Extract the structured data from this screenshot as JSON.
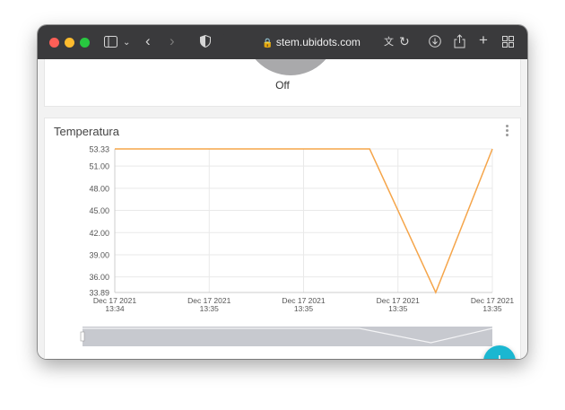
{
  "browser": {
    "url": "stem.ubidots.com",
    "colors": {
      "close": "#fe5f57",
      "minimize": "#febc2e",
      "zoom": "#28c840"
    }
  },
  "switch_widget": {
    "status": "Off"
  },
  "chart_widget": {
    "title": "Temperatura",
    "accent": "#f5a54a",
    "fab_label": "+"
  },
  "chart_data": {
    "type": "line",
    "title": "Temperatura",
    "xlabel": "",
    "ylabel": "",
    "y_ticks": [
      "53.33",
      "51.00",
      "48.00",
      "45.00",
      "42.00",
      "39.00",
      "36.00",
      "33.89"
    ],
    "ylim": [
      33.89,
      53.33
    ],
    "x_ticks": [
      {
        "date": "Dec 17 2021",
        "time": "13:34"
      },
      {
        "date": "Dec 17 2021",
        "time": "13:35"
      },
      {
        "date": "Dec 17 2021",
        "time": "13:35"
      },
      {
        "date": "Dec 17 2021",
        "time": "13:35"
      },
      {
        "date": "Dec 17 2021",
        "time": "13:35"
      }
    ],
    "series": [
      {
        "color": "#f5a54a",
        "points": [
          {
            "x": 0.0,
            "y": 53.33
          },
          {
            "x": 2.7,
            "y": 53.33
          },
          {
            "x": 3.4,
            "y": 33.89
          },
          {
            "x": 4.0,
            "y": 53.33
          }
        ]
      }
    ],
    "grid": true
  }
}
